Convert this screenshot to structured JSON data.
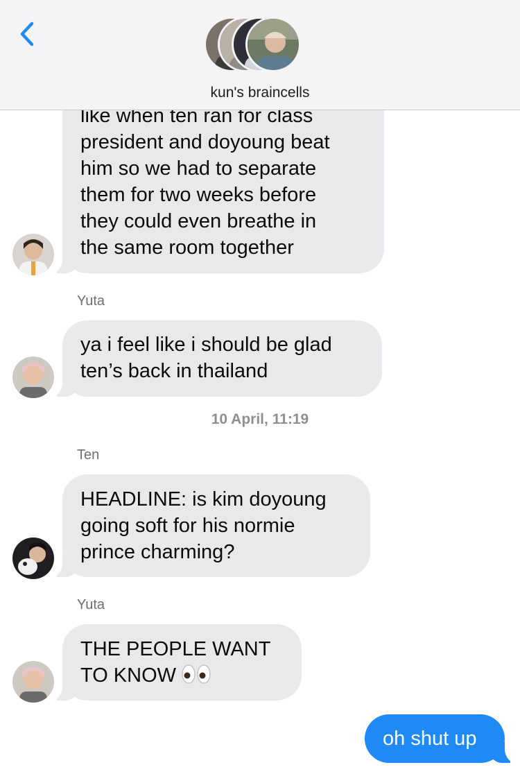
{
  "header": {
    "back_icon": "chevron-left-icon",
    "group_title": "kun's braincells",
    "accent_color": "#1f8af5"
  },
  "messages": [
    {
      "type": "incoming",
      "lines": [
        "like when ten ran for class",
        "president and doyoung beat",
        "him so we had to separate",
        "them for two weeks before",
        "they could even breathe in",
        "the same room together"
      ]
    },
    {
      "type": "sender",
      "name": "Yuta"
    },
    {
      "type": "incoming",
      "lines": [
        "ya i feel like i should be glad",
        "ten’s back in thailand"
      ]
    },
    {
      "type": "timestamp",
      "date": "10 April,",
      "time": "11:19"
    },
    {
      "type": "sender",
      "name": "Ten"
    },
    {
      "type": "incoming",
      "lines": [
        "HEADLINE: is kim doyoung",
        "going soft for his normie",
        "prince charming?"
      ]
    },
    {
      "type": "sender",
      "name": "Yuta"
    },
    {
      "type": "incoming",
      "lines": [
        "THE PEOPLE WANT",
        "TO KNOW"
      ],
      "emoji": "eyes-emoji"
    },
    {
      "type": "outgoing",
      "lines": [
        "oh shut up"
      ]
    }
  ],
  "colors": {
    "incoming_bubble": "#e9e9eb",
    "outgoing_bubble": "#1f8af5",
    "header_bg": "#f4f4f6"
  }
}
